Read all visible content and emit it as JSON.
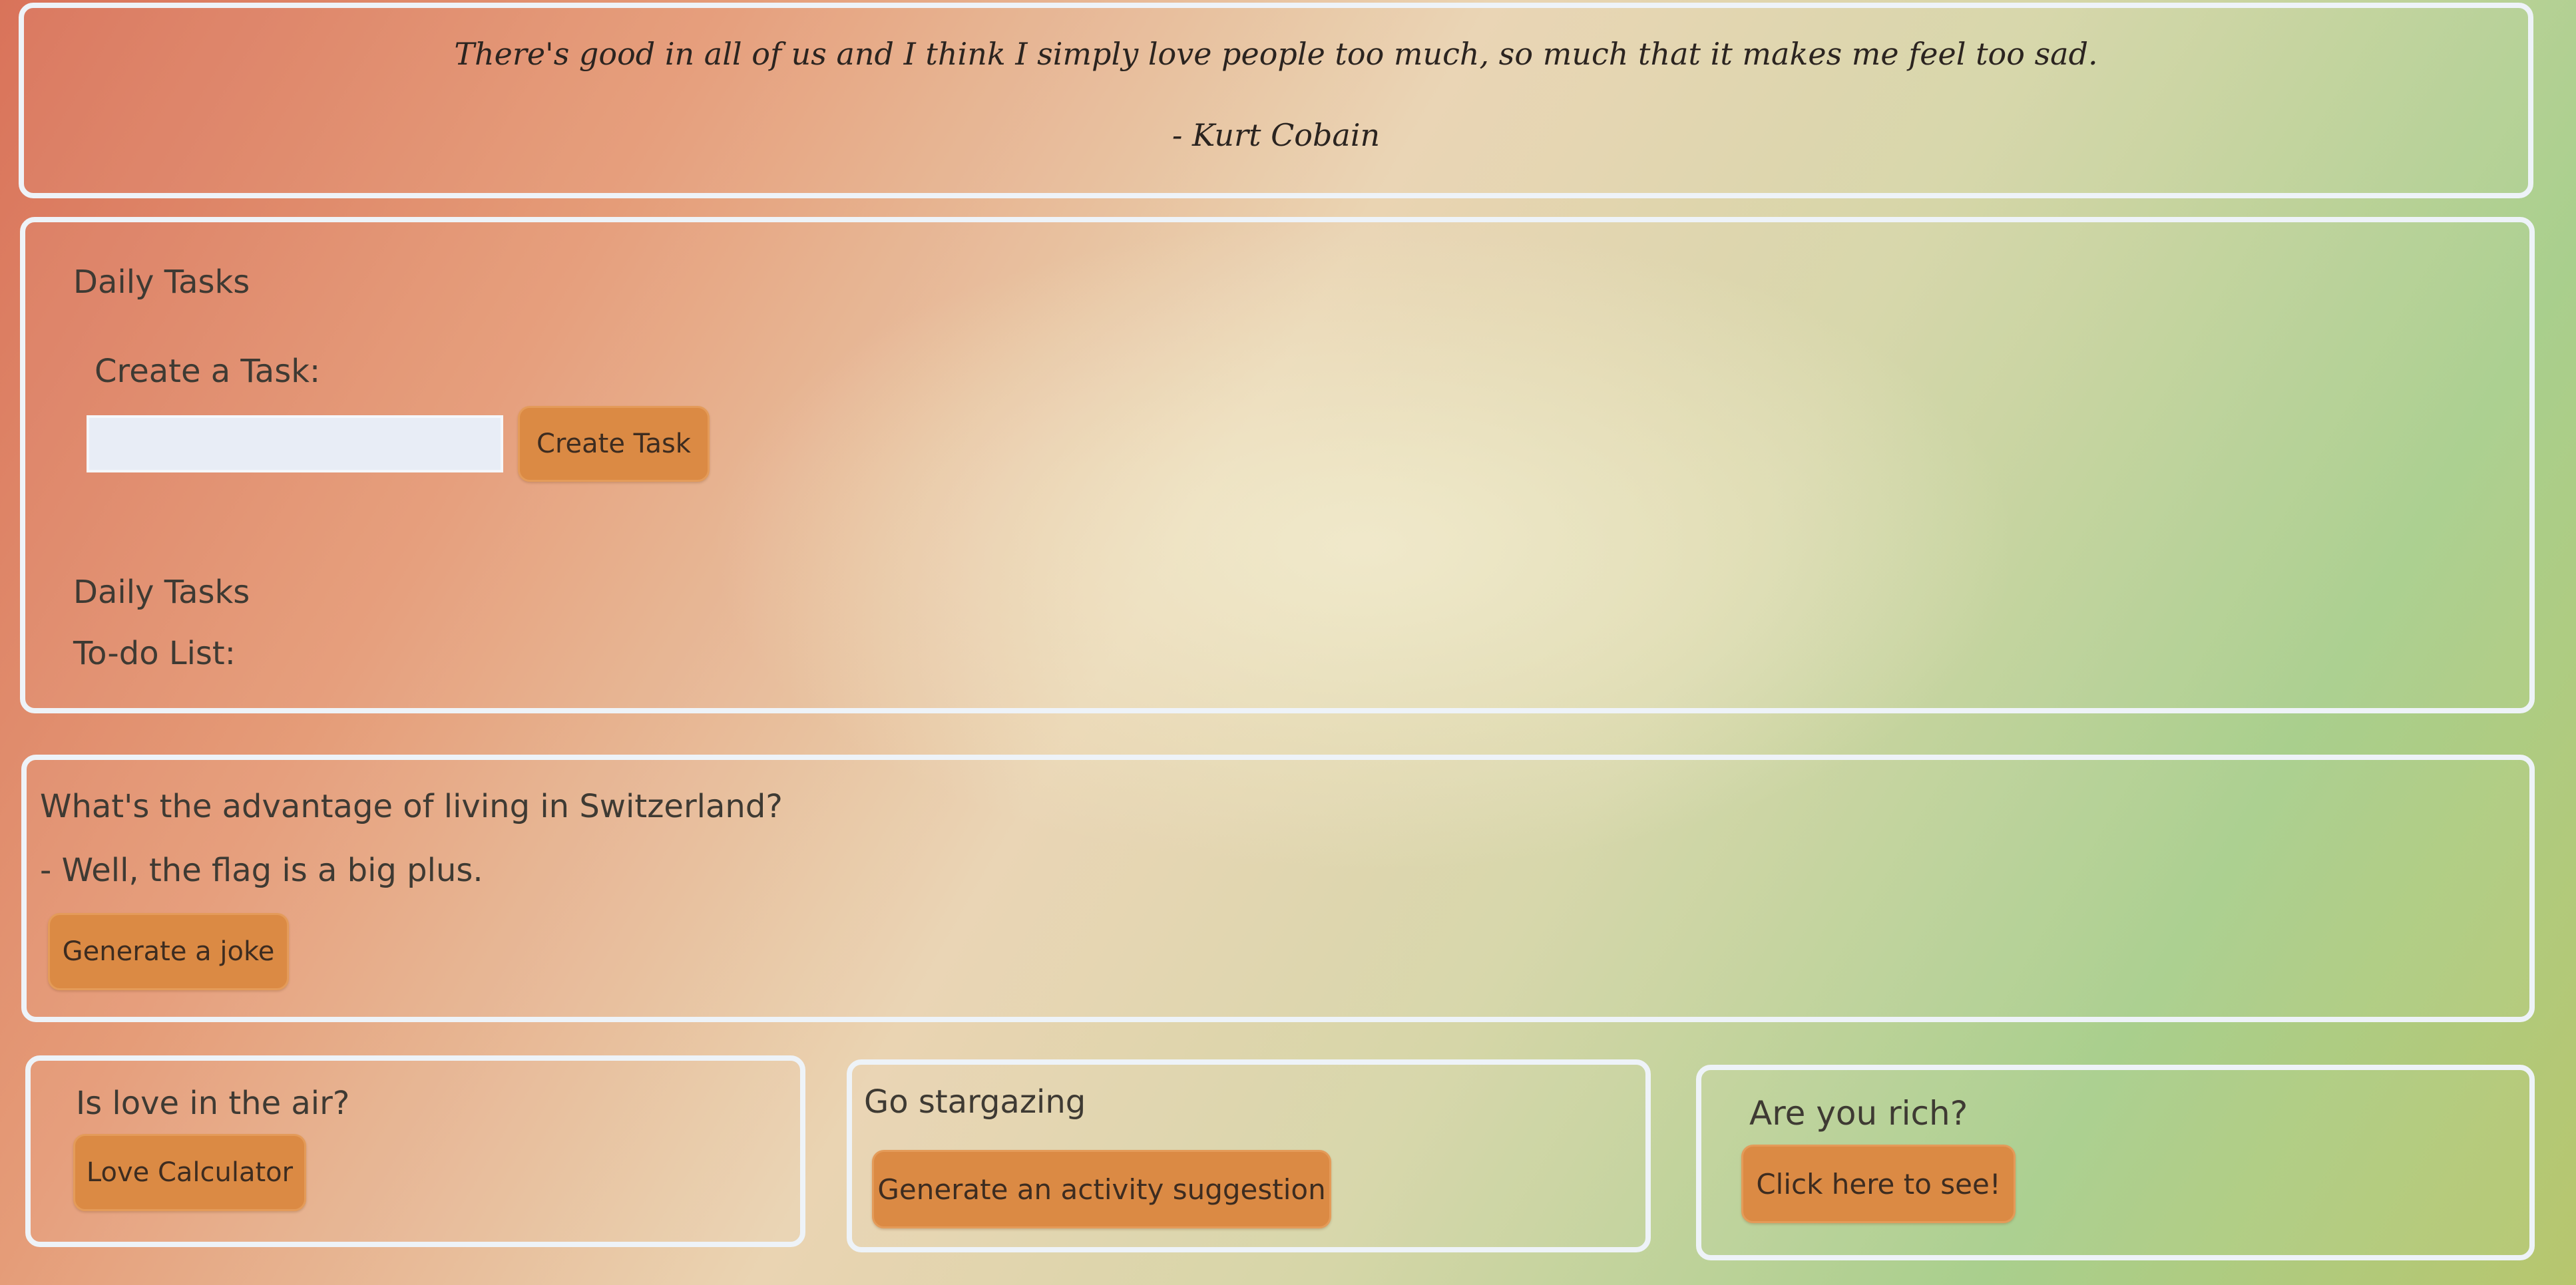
{
  "quote": {
    "text": "There's good in all of us and I think I simply love people too much, so much that it makes me feel too sad.",
    "author": "- Kurt Cobain"
  },
  "tasks": {
    "heading": "Daily Tasks",
    "create_label": "Create a Task:",
    "input_value": "",
    "create_button": "Create Task",
    "list_heading": "Daily Tasks",
    "todo_label": "To-do List:"
  },
  "joke": {
    "question": "What's the advantage of living in Switzerland?",
    "answer": "- Well, the flag is a big plus.",
    "button": "Generate a joke"
  },
  "love": {
    "heading": "Is love in the air?",
    "button": "Love Calculator"
  },
  "stargazing": {
    "heading": "Go stargazing",
    "button": "Generate an activity suggestion"
  },
  "rich": {
    "heading": "Are you rich?",
    "button": "Click here to see!"
  }
}
